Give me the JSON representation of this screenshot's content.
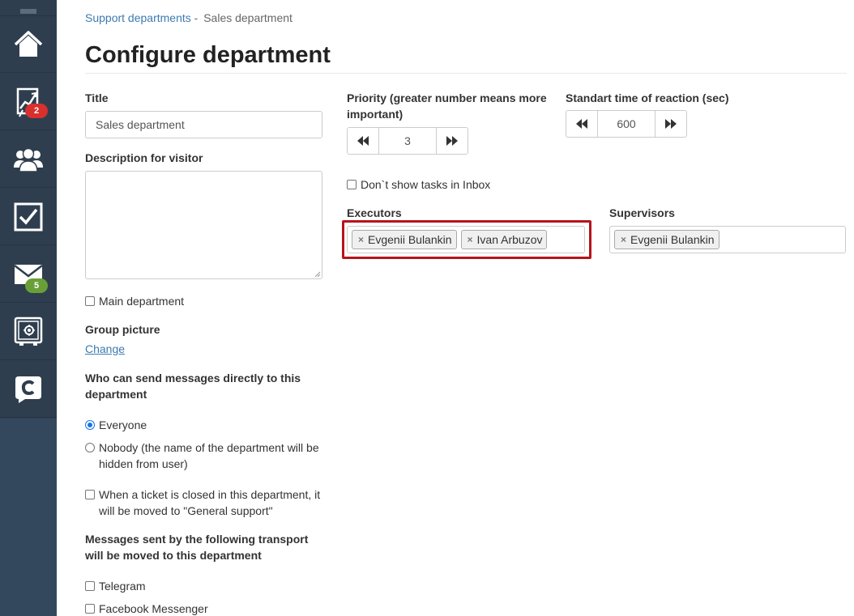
{
  "sidebar": {
    "items": [
      {
        "icon": "home-icon"
      },
      {
        "icon": "chart-icon",
        "badge": "2"
      },
      {
        "icon": "users-icon"
      },
      {
        "icon": "tasks-icon"
      },
      {
        "icon": "mail-icon",
        "badge": "5"
      },
      {
        "icon": "safe-icon"
      },
      {
        "icon": "chat-logo-icon"
      }
    ]
  },
  "breadcrumb": {
    "parent": "Support departments",
    "separator": "-",
    "current": "Sales department"
  },
  "page_title": "Configure department",
  "form": {
    "title_label": "Title",
    "title_value": "Sales department",
    "description_label": "Description for visitor",
    "description_value": "",
    "main_department_label": "Main department",
    "group_picture_label": "Group picture",
    "group_picture_change": "Change",
    "who_can_send_label": "Who can send messages directly to this department",
    "radio_everyone": "Everyone",
    "radio_nobody": "Nobody (the name of the department will be hidden from user)",
    "ticket_closed_label": "When a ticket is closed in this department, it will be moved to \"General support\"",
    "transport_label": "Messages sent by the following transport will be moved to this department",
    "transport_telegram": "Telegram",
    "transport_facebook": "Facebook Messenger",
    "priority_label": "Priority (greater number means more important)",
    "priority_value": "3",
    "reaction_label": "Standart time of reaction (sec)",
    "reaction_value": "600",
    "dont_show_inbox_label": "Don`t show tasks in Inbox",
    "executors_label": "Executors",
    "executors": [
      "Evgenii Bulankin",
      "Ivan Arbuzov"
    ],
    "supervisors_label": "Supervisors",
    "supervisors": [
      "Evgenii Bulankin"
    ],
    "remove_symbol": "×"
  },
  "colors": {
    "sidebar_bg": "#2f3e4f",
    "badge_red": "#d9302d",
    "badge_green": "#6a9f37",
    "link": "#3d7ab0",
    "highlight": "#b7131b"
  }
}
